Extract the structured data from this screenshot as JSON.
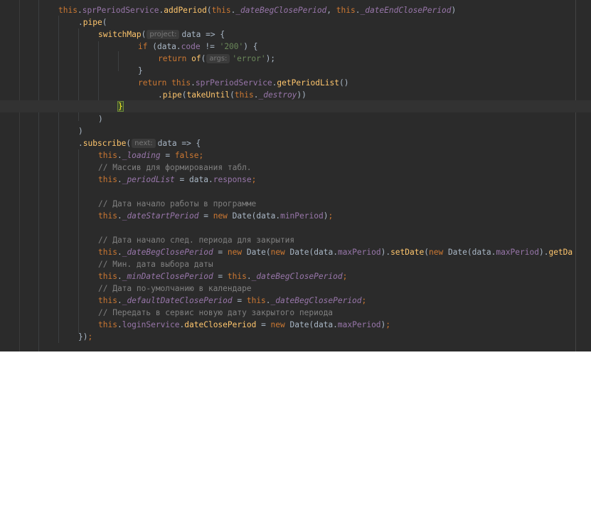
{
  "hints": {
    "project": "project:",
    "args": "args:",
    "next": "next:"
  },
  "code": {
    "this": "this",
    "new": "new",
    "return": "return",
    "if": "if",
    "of": "of",
    "false": "false",
    "sprPeriodService": "sprPeriodService",
    "addPeriod": "addPeriod",
    "getPeriodList": "getPeriodList",
    "pipe": "pipe",
    "switchMap": "switchMap",
    "takeUntil": "takeUntil",
    "subscribe": "subscribe",
    "data": "data",
    "code": "code",
    "response": "response",
    "Date": "Date",
    "minPeriod": "minPeriod",
    "maxPeriod": "maxPeriod",
    "setDate": "setDate",
    "getDa": "getDa",
    "loginService": "loginService",
    "dateClosePeriod": "dateClosePeriod",
    "_dateBegClosePeriod": "_dateBegClosePeriod",
    "_dateEndClosePeriod": "_dateEndClosePeriod",
    "_destroy": "_destroy",
    "_loading": "_loading",
    "_periodList": "_periodList",
    "_dateStartPeriod": "_dateStartPeriod",
    "_minDateClosePeriod": "_minDateClosePeriod",
    "_defaultDateClosePeriod": "_defaultDateClosePeriod",
    "str200": "'200'",
    "strError": "'error'"
  },
  "comments": {
    "c1": "// Массив для формирования табл.",
    "c2": "// Дата начало работы в программе",
    "c3": "// Дата начало след. периода для закрытия",
    "c4": "// Мин. дата выбора даты",
    "c5": "// Дата по-умолчанию в календаре",
    "c6": "// Передать в сервис новую дату закрытого периода"
  }
}
